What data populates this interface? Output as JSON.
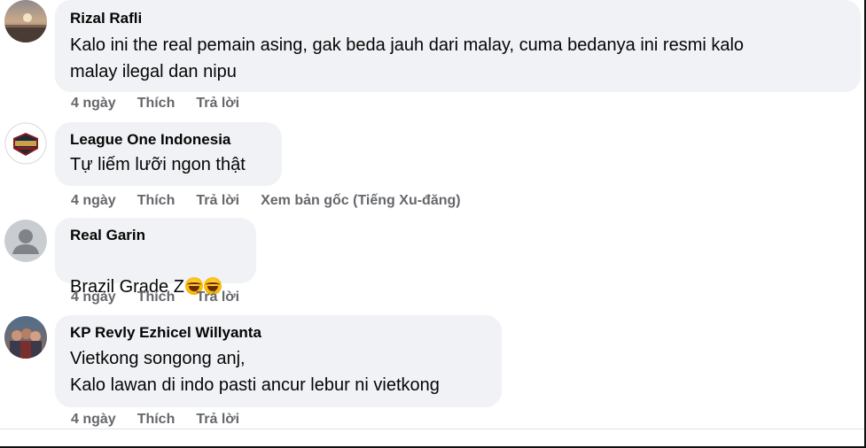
{
  "comments": [
    {
      "author": "Rizal Rafli",
      "text": "Kalo ini the real pemain asing, gak beda jauh dari malay, cuma bedanya ini resmi kalo\nmalay ilegal dan nipu",
      "time": "4 ngày",
      "like": "Thích",
      "reply": "Trả lời"
    },
    {
      "author": "League One Indonesia",
      "text": "Tự liếm lưỡi ngon thật",
      "time": "4 ngày",
      "like": "Thích",
      "reply": "Trả lời",
      "see_original": "Xem bản gốc (Tiếng Xu-đăng)"
    },
    {
      "author": "Real Garin",
      "text": "Brazil Grade Z",
      "emoji": "rolling-on-the-floor-laughing-icon",
      "time": "4 ngày",
      "like": "Thích",
      "reply": "Trả lời"
    },
    {
      "author": "KP Revly Ezhicel Willyanta",
      "text": "Vietkong songong anj,\nKalo lawan di indo pasti ancur lebur ni vietkong",
      "time": "4 ngày",
      "like": "Thích",
      "reply": "Trả lời"
    }
  ],
  "colors": {
    "bubble": "#f0f2f5",
    "secondary_text": "#65676b",
    "primary_text": "#050505"
  }
}
